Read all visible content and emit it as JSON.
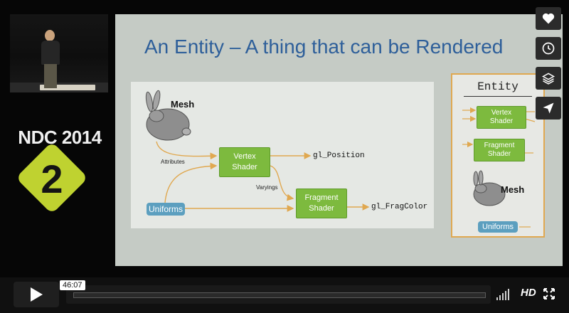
{
  "speaker_camera": {
    "description_icon": "speaker-video-icon"
  },
  "logo": {
    "event": "NDC 2014",
    "day": "2",
    "color": "#bfd230"
  },
  "slide": {
    "title": "An Entity – A thing that can be Rendered",
    "diagram": {
      "mesh_label": "Mesh",
      "vertex_shader": "Vertex\nShader",
      "fragment_shader": "Fragment\nShader",
      "uniforms": "Uniforms",
      "attributes": "Attributes",
      "varyings": "Varyings",
      "gl_position": "gl_Position",
      "gl_fragcolor": "gl_FragColor"
    },
    "entity_panel": {
      "title": "Entity",
      "vertex_shader": "Vertex\nShader",
      "fragment_shader": "Fragment\nShader",
      "mesh_label": "Mesh",
      "uniforms": "Uniforms"
    },
    "colors": {
      "title": "#2e5f9a",
      "shader": "#7dba3e",
      "uniforms": "#5c9fbf",
      "arrow": "#e0a850"
    }
  },
  "side_actions": [
    {
      "name": "like",
      "icon": "heart-icon"
    },
    {
      "name": "watch-later",
      "icon": "clock-icon"
    },
    {
      "name": "collections",
      "icon": "layers-icon"
    },
    {
      "name": "share",
      "icon": "send-icon"
    }
  ],
  "player": {
    "time": "46:07",
    "progress_fraction": 0.0,
    "quality": "HD",
    "accent": "#00adef"
  }
}
